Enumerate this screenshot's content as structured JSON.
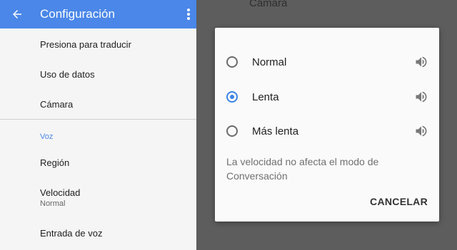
{
  "appbar": {
    "title": "Configuración"
  },
  "settings": {
    "translate_tap": "Presiona para traducir",
    "data_usage": "Uso de datos",
    "camera": "Cámara",
    "voice_section": "Voz",
    "region": "Región",
    "speed_label": "Velocidad",
    "speed_value": "Normal",
    "voice_input": "Entrada de voz"
  },
  "background": {
    "camera_header": "Cámara"
  },
  "dialog": {
    "options": [
      {
        "label": "Normal",
        "selected": false
      },
      {
        "label": "Lenta",
        "selected": true
      },
      {
        "label": "Más lenta",
        "selected": false
      }
    ],
    "note": "La velocidad no afecta el modo de Conversación",
    "cancel": "CANCELAR"
  },
  "colors": {
    "accent": "#4a87e8",
    "radio_selected": "#3b82e6"
  }
}
